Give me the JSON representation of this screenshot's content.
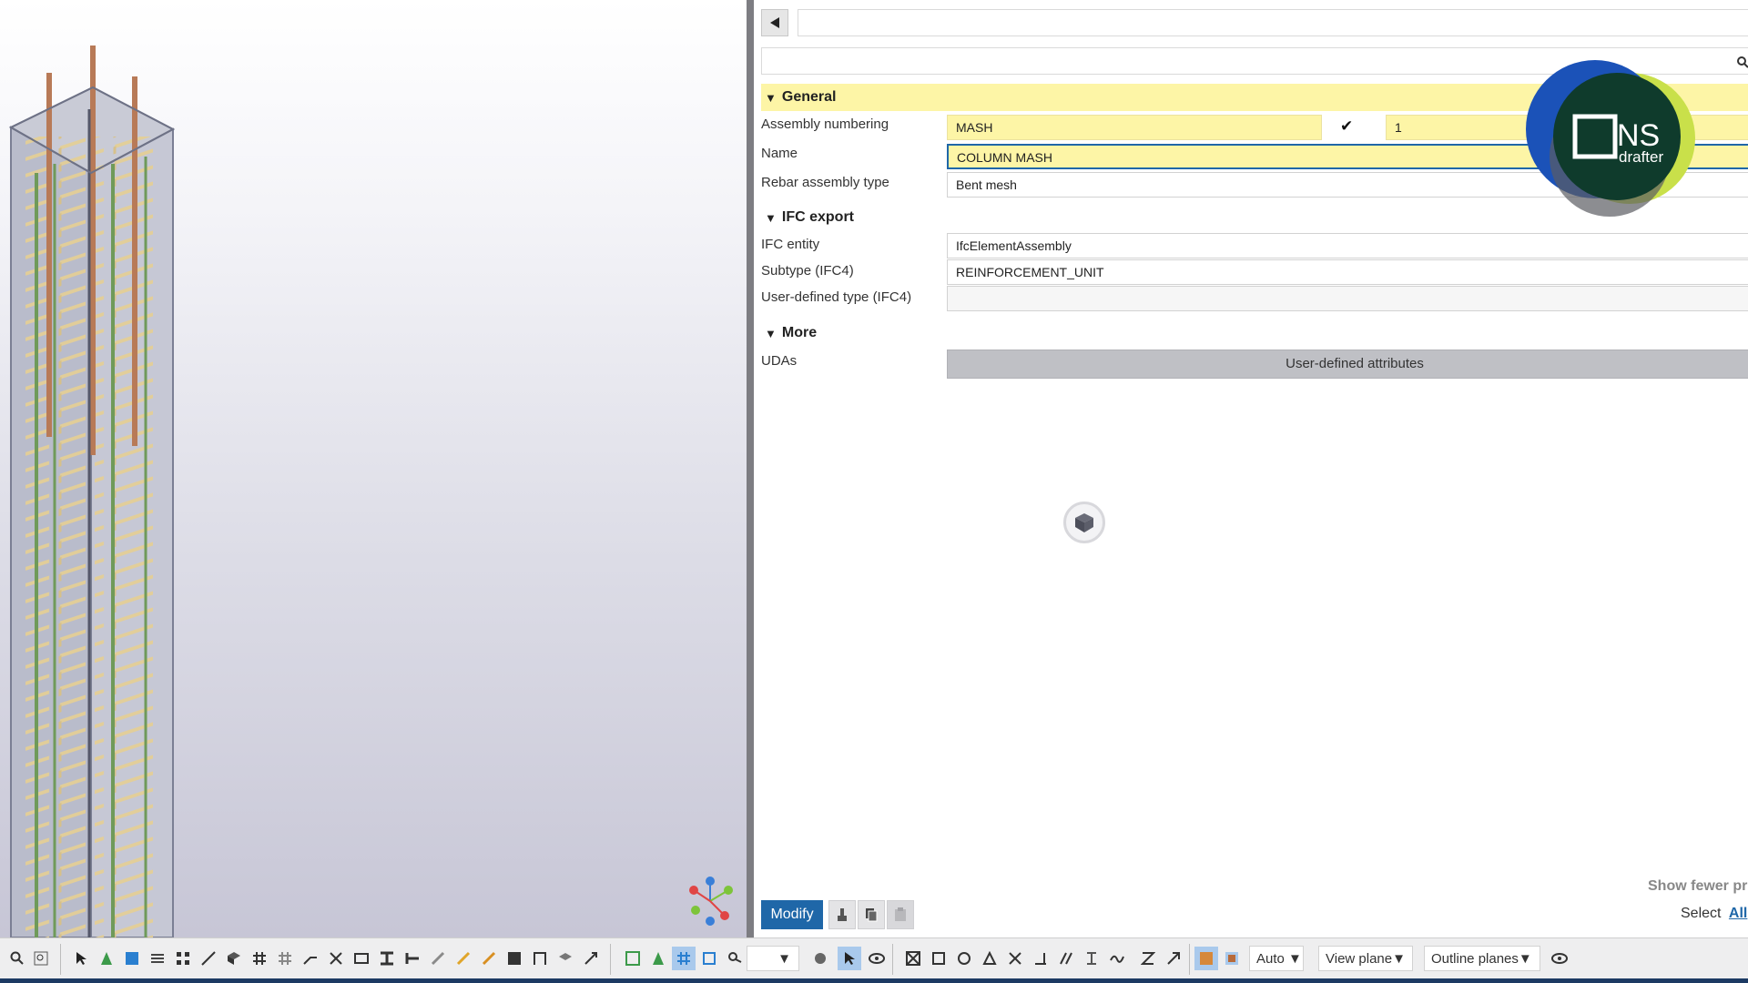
{
  "panel": {
    "search": {
      "placeholder": ""
    },
    "sections": {
      "general": {
        "title": "General"
      },
      "ifc": {
        "title": "IFC export"
      },
      "more": {
        "title": "More"
      }
    },
    "fields": {
      "assembly_numbering": {
        "label": "Assembly numbering",
        "prefix": "MASH",
        "start": "1"
      },
      "name": {
        "label": "Name",
        "value": "COLUMN MASH"
      },
      "rebar_assembly_type": {
        "label": "Rebar assembly type",
        "value": "Bent mesh"
      },
      "ifc_entity": {
        "label": "IFC entity",
        "value": "IfcElementAssembly"
      },
      "subtype": {
        "label": "Subtype (IFC4)",
        "value": "REINFORCEMENT_UNIT"
      },
      "user_defined_type": {
        "label": "User-defined type (IFC4)",
        "value": ""
      },
      "udas": {
        "label": "UDAs",
        "button": "User-defined attributes"
      }
    },
    "logo": {
      "text_main": "NS",
      "text_sub": "drafter"
    },
    "footer": {
      "show_fewer": "Show fewer pro",
      "select_label": "Select",
      "select_all": "All"
    },
    "modify_label": "Modify"
  },
  "toolbar": {
    "dropdowns": {
      "auto": "Auto",
      "view_plane": "View plane",
      "outline_planes": "Outline planes"
    }
  },
  "colors": {
    "accent": "#1f67a8",
    "section_bg": "#fdf5a6",
    "splitter": "#7d7d82",
    "status_bar": "#1c3a63"
  }
}
